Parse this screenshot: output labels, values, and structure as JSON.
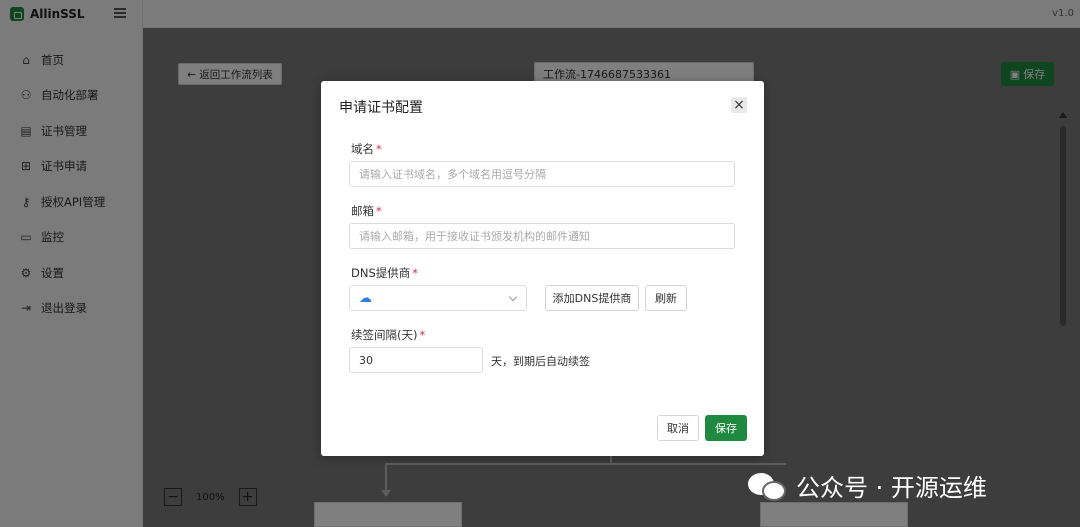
{
  "app": {
    "name": "AllinSSL",
    "version": "v1.0"
  },
  "sidebar": {
    "items": [
      {
        "label": "首页",
        "icon": "home-icon"
      },
      {
        "label": "自动化部署",
        "icon": "workflow-icon"
      },
      {
        "label": "证书管理",
        "icon": "certificate-icon"
      },
      {
        "label": "证书申请",
        "icon": "plus-square-icon"
      },
      {
        "label": "授权API管理",
        "icon": "key-icon"
      },
      {
        "label": "监控",
        "icon": "monitor-icon"
      },
      {
        "label": "设置",
        "icon": "gear-icon"
      },
      {
        "label": "退出登录",
        "icon": "logout-icon"
      }
    ]
  },
  "toolbar": {
    "back_label": "← 返回工作流列表",
    "workflow_name": "工作流-1746687533361",
    "save_label": "保存"
  },
  "zoom": {
    "minus": "−",
    "level": "100%",
    "plus": "+"
  },
  "modal": {
    "title": "申请证书配置",
    "close": "×",
    "domain": {
      "label": "域名",
      "placeholder": "请输入证书域名，多个域名用逗号分隔"
    },
    "email": {
      "label": "邮箱",
      "placeholder": "请输入邮箱，用于接收证书颁发机构的邮件通知"
    },
    "dns": {
      "label": "DNS提供商",
      "selected_icon": "cloud-icon",
      "add_label": "添加DNS提供商",
      "refresh_label": "刷新"
    },
    "renew": {
      "label": "续签间隔(天)",
      "value": "30",
      "suffix": "天，到期后自动续签"
    },
    "required_mark": "*",
    "cancel_label": "取消",
    "save_label": "保存"
  },
  "watermark": {
    "text": "公众号 · 开源运维"
  },
  "colors": {
    "accent": "#1f8a3f",
    "required": "#d03050",
    "cloud": "#2f7fdc"
  }
}
